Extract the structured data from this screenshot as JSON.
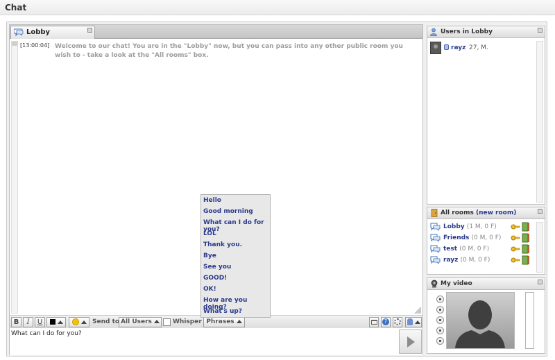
{
  "page": {
    "title": "Chat"
  },
  "chat": {
    "tab_label": "Lobby",
    "messages": [
      {
        "time": "[13:00:04]",
        "text": "Welcome to our chat! You are in the \"Lobby\" now, but you can pass into any other public room you wish to - take a look at the \"All rooms\" box."
      }
    ],
    "toolbar": {
      "bold": "B",
      "italic": "I",
      "underline": "U",
      "send_to_label": "Send to:",
      "send_to_value": "All Users",
      "whisper_label": "Whisper",
      "phrases_label": "Phrases"
    },
    "input_value": "What can I do for you?",
    "phrases": [
      "Hello",
      "Good morning",
      "What can I do for you?",
      "LOL",
      "Thank you.",
      "Bye",
      "See you",
      "GOOD!",
      "OK!",
      "How are you doing?",
      "What's up?"
    ]
  },
  "users_box": {
    "title": "Users in Lobby",
    "users": [
      {
        "name": "rayz",
        "meta": "27, M."
      }
    ]
  },
  "rooms_box": {
    "title": "All rooms",
    "new_room_link": "(new room)",
    "rooms": [
      {
        "name": "Lobby",
        "count": "(1 M, 0 F)"
      },
      {
        "name": "Friends",
        "count": "(0 M, 0 F)"
      },
      {
        "name": "test",
        "count": "(0 M, 0 F)"
      },
      {
        "name": "rayz",
        "count": "(0 M, 0 F)"
      }
    ]
  },
  "video_box": {
    "title": "My video"
  },
  "colors": {
    "accent_link": "#2b3a8a",
    "message_text": "#9e9e9e"
  },
  "icons": [
    "chat-bubble-icon",
    "user-group-icon",
    "door-icon",
    "camera-icon",
    "key-icon",
    "lock-icon",
    "smiley-icon",
    "help-icon",
    "settings-icon",
    "window-icon",
    "play-icon",
    "pause-icon",
    "stop-icon",
    "rewind-icon",
    "audio-icon"
  ]
}
